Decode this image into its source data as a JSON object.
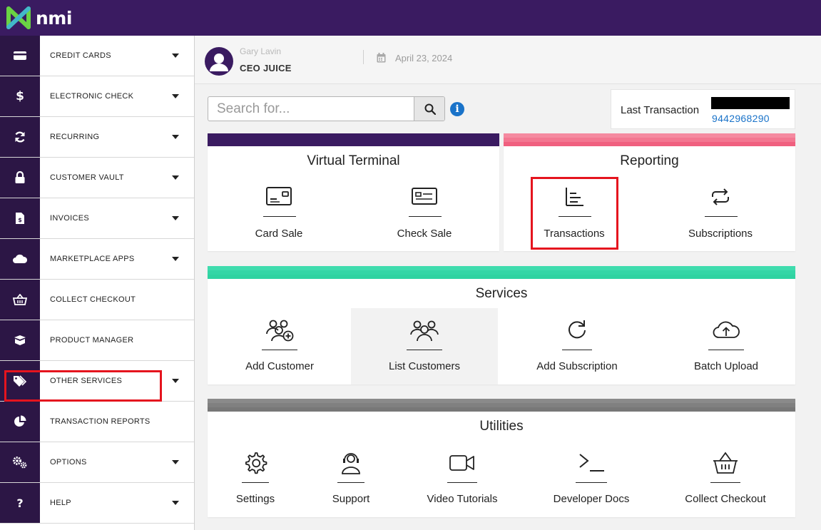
{
  "brand": {
    "logo_text": "nmi",
    "topbar_color": "#3a1b61",
    "accent_green": "#6ad344"
  },
  "sidebar": {
    "items": [
      {
        "label": "CREDIT CARDS",
        "icon": "credit-card-icon",
        "has_caret": true
      },
      {
        "label": "ELECTRONIC CHECK",
        "icon": "dollar-icon",
        "has_caret": true
      },
      {
        "label": "RECURRING",
        "icon": "sync-icon",
        "has_caret": true
      },
      {
        "label": "CUSTOMER VAULT",
        "icon": "lock-icon",
        "has_caret": true
      },
      {
        "label": "INVOICES",
        "icon": "invoice-icon",
        "has_caret": true
      },
      {
        "label": "MARKETPLACE APPS",
        "icon": "cloud-icon",
        "has_caret": true
      },
      {
        "label": "COLLECT CHECKOUT",
        "icon": "basket-icon",
        "has_caret": false
      },
      {
        "label": "PRODUCT MANAGER",
        "icon": "box-icon",
        "has_caret": false
      },
      {
        "label": "OTHER SERVICES",
        "icon": "tags-icon",
        "has_caret": true
      },
      {
        "label": "TRANSACTION REPORTS",
        "icon": "pie-chart-icon",
        "has_caret": false
      },
      {
        "label": "OPTIONS",
        "icon": "gears-icon",
        "has_caret": true
      },
      {
        "label": "HELP",
        "icon": "question-icon",
        "has_caret": true
      }
    ]
  },
  "header": {
    "user_name": "Gary Lavin",
    "company": "CEO JUICE",
    "date": "April 23, 2024"
  },
  "search": {
    "placeholder": "Search for..."
  },
  "last_transaction": {
    "label": "Last Transaction",
    "id": "9442968290"
  },
  "virtual_terminal": {
    "title": "Virtual Terminal",
    "color": "#3a1b61",
    "tiles": [
      "Card Sale",
      "Check Sale"
    ]
  },
  "reporting": {
    "title": "Reporting",
    "color": "#f0607f",
    "tiles": [
      "Transactions",
      "Subscriptions"
    ]
  },
  "services": {
    "title": "Services",
    "color": "#2fd3a1",
    "tiles": [
      "Add Customer",
      "List Customers",
      "Add Subscription",
      "Batch Upload"
    ]
  },
  "utilities": {
    "title": "Utilities",
    "color": "#777777",
    "tiles": [
      "Settings",
      "Support",
      "Video Tutorials",
      "Developer Docs",
      "Collect Checkout"
    ]
  }
}
